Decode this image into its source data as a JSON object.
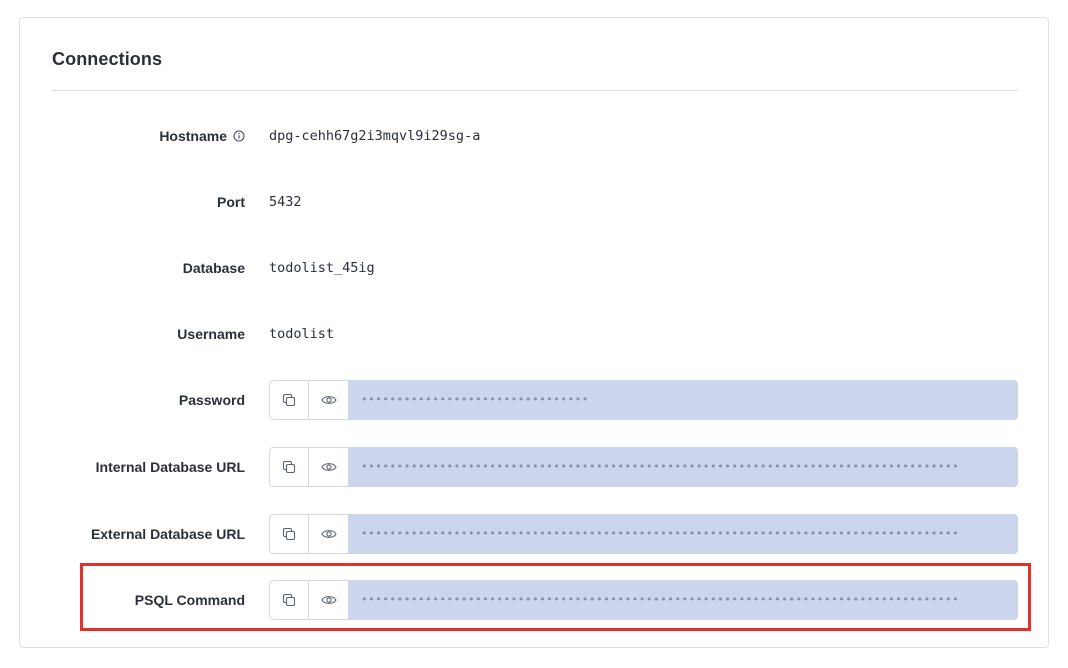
{
  "section": {
    "title": "Connections"
  },
  "fields": {
    "hostname": {
      "label": "Hostname",
      "value": "dpg-cehh67g2i3mqvl9i29sg-a"
    },
    "port": {
      "label": "Port",
      "value": "5432"
    },
    "database": {
      "label": "Database",
      "value": "todolist_45ig"
    },
    "username": {
      "label": "Username",
      "value": "todolist"
    },
    "password": {
      "label": "Password",
      "masked": "••••••••••••••••••••••••••••••••"
    },
    "internal_url": {
      "label": "Internal Database URL",
      "masked": "••••••••••••••••••••••••••••••••••••••••••••••••••••••••••••••••••••••••••••••••••••"
    },
    "external_url": {
      "label": "External Database URL",
      "masked": "••••••••••••••••••••••••••••••••••••••••••••••••••••••••••••••••••••••••••••••••••••"
    },
    "psql_command": {
      "label": "PSQL Command",
      "masked": "••••••••••••••••••••••••••••••••••••••••••••••••••••••••••••••••••••••••••••••••••••"
    }
  },
  "icons": {
    "info": "info-circle-icon",
    "copy": "copy-icon",
    "reveal": "eye-icon"
  },
  "colors": {
    "highlight_border": "#e2322a",
    "masked_background": "#cbd6ee"
  }
}
